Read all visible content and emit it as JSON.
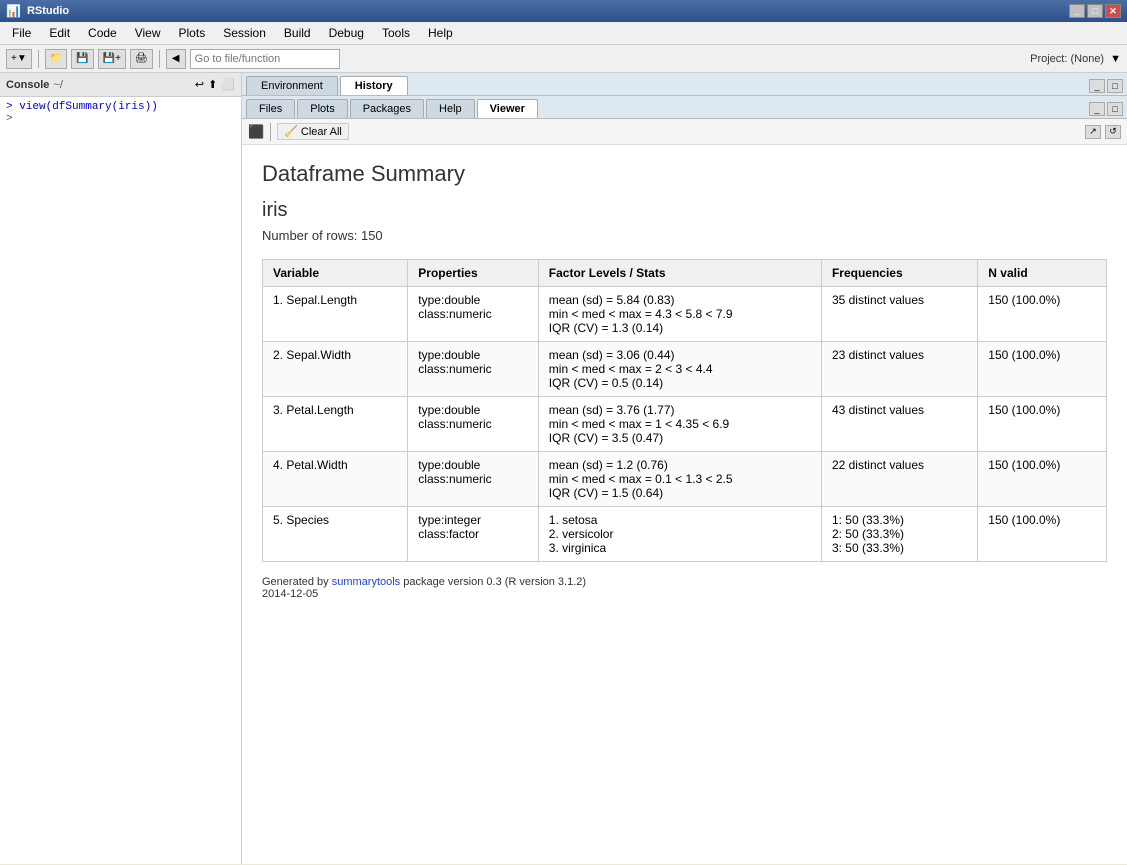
{
  "titleBar": {
    "title": "RStudio",
    "icon": "R"
  },
  "menuBar": {
    "items": [
      "File",
      "Edit",
      "Code",
      "View",
      "Plots",
      "Session",
      "Build",
      "Debug",
      "Tools",
      "Help"
    ]
  },
  "toolbar": {
    "gotoPlaceholder": "Go to file/function",
    "projectLabel": "Project: (None)"
  },
  "leftPanel": {
    "tabLabel": "Console",
    "pathLabel": "~/",
    "command": "> view(dfSummary(iris))",
    "prompt": ">"
  },
  "rightTopPanel": {
    "tabs": [
      "Environment",
      "History"
    ],
    "activeTab": "History"
  },
  "viewerPanel": {
    "tabs": [
      "Files",
      "Plots",
      "Packages",
      "Help",
      "Viewer"
    ],
    "activeTab": "Viewer",
    "clearButtonLabel": "Clear All"
  },
  "viewer": {
    "mainTitle": "Dataframe Summary",
    "dataframeName": "iris",
    "rowCount": "Number of rows: 150",
    "tableHeaders": [
      "Variable",
      "Properties",
      "Factor Levels / Stats",
      "Frequencies",
      "N valid"
    ],
    "rows": [
      {
        "variable": "1. Sepal.Length",
        "properties": "type:double\nclass:numeric",
        "stats": "mean (sd) = 5.84 (0.83)\nmin < med < max = 4.3 < 5.8 < 7.9\nIQR (CV) = 1.3 (0.14)",
        "frequencies": "35 distinct values",
        "nvalid": "150 (100.0%)"
      },
      {
        "variable": "2. Sepal.Width",
        "properties": "type:double\nclass:numeric",
        "stats": "mean (sd) = 3.06 (0.44)\nmin < med < max = 2 < 3 < 4.4\nIQR (CV) = 0.5 (0.14)",
        "frequencies": "23 distinct values",
        "nvalid": "150 (100.0%)"
      },
      {
        "variable": "3. Petal.Length",
        "properties": "type:double\nclass:numeric",
        "stats": "mean (sd) = 3.76 (1.77)\nmin < med < max = 1 < 4.35 < 6.9\nIQR (CV) = 3.5 (0.47)",
        "frequencies": "43 distinct values",
        "nvalid": "150 (100.0%)"
      },
      {
        "variable": "4. Petal.Width",
        "properties": "type:double\nclass:numeric",
        "stats": "mean (sd) = 1.2 (0.76)\nmin < med < max = 0.1 < 1.3 < 2.5\nIQR (CV) = 1.5 (0.64)",
        "frequencies": "22 distinct values",
        "nvalid": "150 (100.0%)"
      },
      {
        "variable": "5. Species",
        "properties": "type:integer\nclass:factor",
        "stats": "1. setosa\n2. versicolor\n3. virginica",
        "frequencies": "1: 50 (33.3%)\n2: 50 (33.3%)\n3: 50 (33.3%)",
        "nvalid": "150 (100.0%)"
      }
    ],
    "footerText": "Generated by ",
    "footerLink": "summarytools",
    "footerSuffix": " package version 0.3 (R version 3.1.2)",
    "footerDate": "2014-12-05"
  }
}
